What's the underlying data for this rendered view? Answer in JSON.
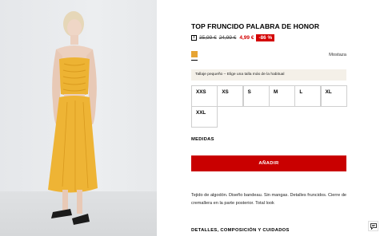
{
  "product": {
    "title": "TOP FRUNCIDO PALABRA DE HONOR",
    "prices": {
      "info_icon": "i",
      "original_1": "35,99 €",
      "original_2": "24,99 €",
      "sale": "4,99 €",
      "discount": "-86 %"
    },
    "color": {
      "name": "Mostaza",
      "swatch_hex": "#e6a434"
    },
    "fit_note": "Tallaje pequeño – Elige una talla más de la habitual",
    "sizes": [
      "XXS",
      "XS",
      "S",
      "M",
      "L",
      "XL",
      "XXL"
    ],
    "measurements_label": "MEDIDAS",
    "add_button_label": "AÑADIR",
    "description": "Tejido de algodón. Diseño bandeau. Sin mangas. Detalles fruncidos. Cierre de cremallera en la parte posterior. Total look",
    "details_heading": "DETALLES, COMPOSICIÓN Y CUIDADOS"
  },
  "accent_colors": {
    "sale_red": "#d40000",
    "button_red": "#c90000"
  },
  "icons": {
    "chat": "chat-icon"
  }
}
